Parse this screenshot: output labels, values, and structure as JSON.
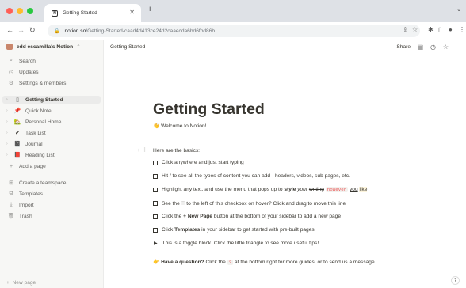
{
  "browser": {
    "tab_title": "Getting Started",
    "tab_favicon": "N",
    "url_domain": "notion.so",
    "url_path": "/Getting-Started-caad4d413ce24d2caaecda6bd6fbd86b",
    "traffic_lights": [
      "#ff5f57",
      "#febc2e",
      "#28c840"
    ]
  },
  "sidebar": {
    "workspace": "edd escamilla's Notion",
    "top_items": [
      {
        "label": "Search",
        "icon": "search-icon"
      },
      {
        "label": "Updates",
        "icon": "clock-icon"
      },
      {
        "label": "Settings & members",
        "icon": "gear-icon"
      }
    ],
    "pages": [
      {
        "label": "Getting Started",
        "icon": "page-icon"
      },
      {
        "label": "Quick Note",
        "icon": "pushpin-icon"
      },
      {
        "label": "Personal Home",
        "icon": "house-icon"
      },
      {
        "label": "Task List",
        "icon": "check-icon"
      },
      {
        "label": "Journal",
        "icon": "notebook-icon"
      },
      {
        "label": "Reading List",
        "icon": "book-icon"
      }
    ],
    "add_page": "Add a page",
    "bottom_items": [
      {
        "label": "Create a teamspace",
        "icon": "teamspace-icon"
      },
      {
        "label": "Templates",
        "icon": "templates-icon"
      },
      {
        "label": "Import",
        "icon": "import-icon"
      },
      {
        "label": "Trash",
        "icon": "trash-icon"
      }
    ],
    "new_page": "New page"
  },
  "main": {
    "breadcrumb": "Getting Started",
    "share": "Share",
    "title": "Getting Started",
    "welcome": "Welcome to Notion!",
    "basics": "Here are the basics:",
    "todo1": "Click anywhere and just start typing",
    "todo2": "Hit / to see all the types of content you can add - headers, videos, sub pages, etc.",
    "todo3a": "Highlight any text, and use the menu that pops up to",
    "todo3b": "style",
    "todo3c": "your",
    "todo3d": "writing",
    "todo3e": "however",
    "todo3f": "you",
    "todo3g": "like",
    "todo4a": "See the",
    "todo4b": "to the left of this checkbox on hover? Click and drag to move this line",
    "todo5a": "Click the",
    "todo5b": "+ New Page",
    "todo5c": "button at the bottom of your sidebar to add a new page",
    "todo6a": "Click",
    "todo6b": "Templates",
    "todo6c": "in your sidebar to get started with pre-built pages",
    "toggle": "This is a toggle block. Click the little triangle to see more useful tips!",
    "question_a": "Have a question?",
    "question_b": "Click the",
    "question_c": "?",
    "question_d": "at the bottom right for more guides, or to send us a message.",
    "help": "?"
  }
}
